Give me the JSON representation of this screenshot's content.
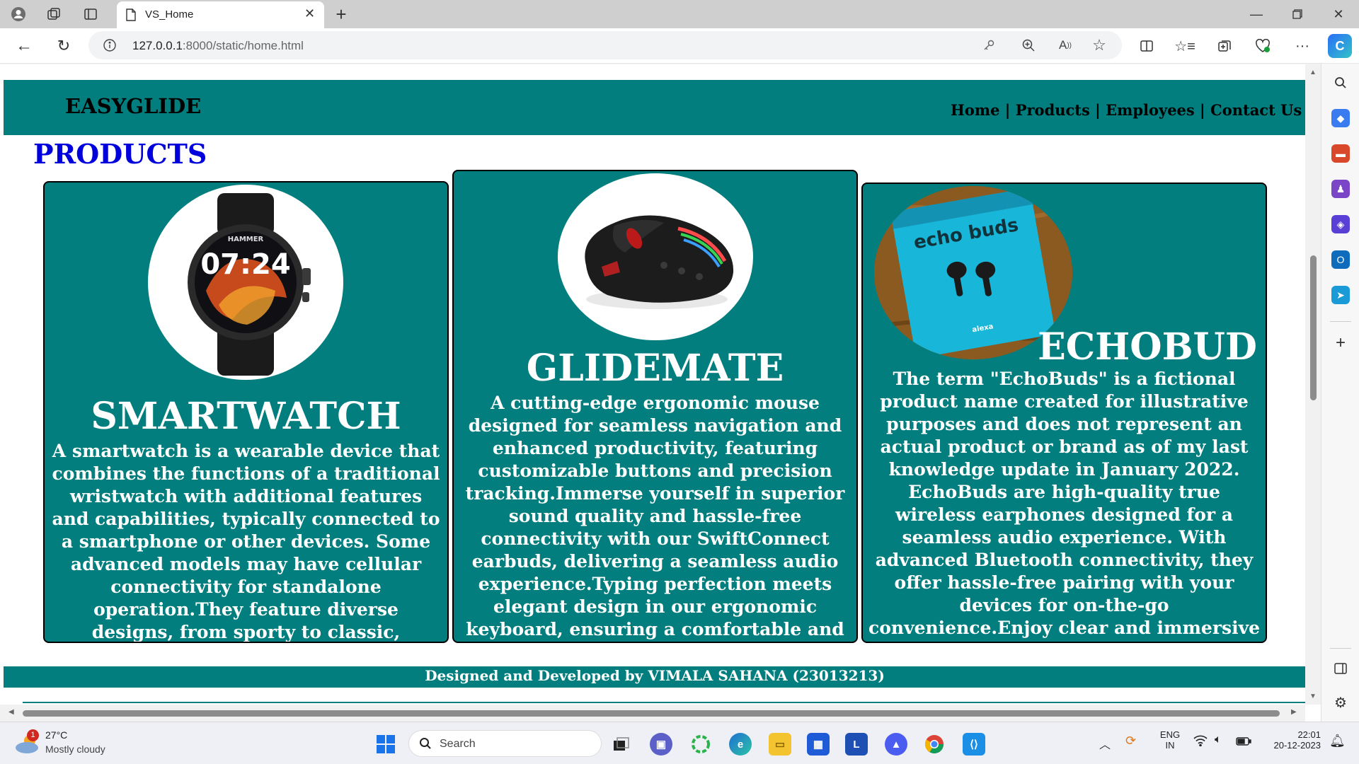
{
  "browser": {
    "tab_title": "VS_Home",
    "url_host": "127.0.0.1",
    "url_path": ":8000/static/home.html"
  },
  "site": {
    "brand": "EASYGLIDE",
    "nav": [
      "Home",
      "Products",
      "Employees",
      "Contact Us"
    ],
    "nav_separator": " | ",
    "heading": "PRODUCTS",
    "footer": "Designed and Developed by VIMALA SAHANA (23013213)"
  },
  "products": [
    {
      "title": "SMARTWATCH",
      "image": "smartwatch",
      "watch_brand": "HAMMER",
      "watch_time": "07:24",
      "description": "A smartwatch is a wearable device that combines the functions of a traditional wristwatch with additional features and capabilities, typically connected to a smartphone or other devices. Some advanced models may have cellular connectivity for standalone operation.They feature diverse designs, from sporty to classic, catering to different styles."
    },
    {
      "title": "GLIDEMATE",
      "image": "gaming-mouse",
      "description": "A cutting-edge ergonomic mouse designed for seamless navigation and enhanced productivity, featuring customizable buttons and precision tracking.Immerse yourself in superior sound quality and hassle-free connectivity with our SwiftConnect earbuds, delivering a seamless audio experience.Typing perfection meets elegant design in our ergonomic keyboard, ensuring a comfortable and efficient typing experience with whisper-quiet keys."
    },
    {
      "title": "ECHOBUD",
      "image": "earbuds-box",
      "box_label": "echo buds",
      "box_sublabel": "alexa",
      "description": "The term \"EchoBuds\" is a fictional product name created for illustrative purposes and does not represent an actual product or brand as of my last knowledge update in January 2022. EchoBuds are high-quality true wireless earphones designed for a seamless audio experience. With advanced Bluetooth connectivity, they offer hassle-free pairing with your devices for on-the-go convenience.Enjoy clear and immersive sound, whether you're taking calls or listening to your favorite"
    }
  ],
  "colors": {
    "teal": "#037e7e",
    "heading_blue": "#0000dd",
    "white": "#ffffff"
  },
  "taskbar": {
    "weather_temp": "27°C",
    "weather_desc": "Mostly cloudy",
    "weather_badge": "1",
    "search_placeholder": "Search",
    "lang": "ENG",
    "region": "IN",
    "time": "22:01",
    "date": "20-12-2023",
    "apps": [
      "windows-start",
      "search",
      "task-view",
      "chat",
      "app-circle",
      "edge",
      "file-explorer",
      "store",
      "l-app",
      "ai-app",
      "chrome",
      "vscode"
    ]
  }
}
